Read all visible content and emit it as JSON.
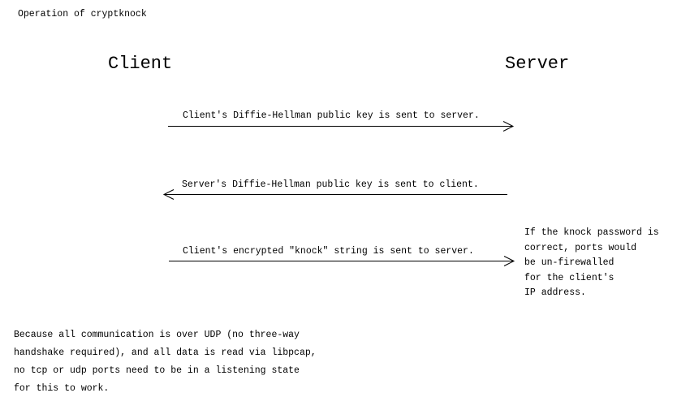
{
  "title": "Operation of cryptknock",
  "actors": {
    "client": "Client",
    "server": "Server"
  },
  "messages": [
    {
      "label": "Client's Diffie-Hellman public key is sent to server.",
      "direction": "client-to-server"
    },
    {
      "label": "Server's Diffie-Hellman public key is sent to client.",
      "direction": "server-to-client"
    },
    {
      "label": "Client's encrypted \"knock\" string is sent to server.",
      "direction": "client-to-server"
    }
  ],
  "note": {
    "lines": [
      "If the knock password is",
      "correct, ports would",
      "be un-firewalled",
      "for the client's",
      "IP address."
    ]
  },
  "footer": {
    "lines": [
      "Because all communication is over UDP (no three-way",
      "handshake required), and all data is read via libpcap,",
      "no tcp or udp ports need to be in a listening state",
      "for this to work."
    ]
  }
}
